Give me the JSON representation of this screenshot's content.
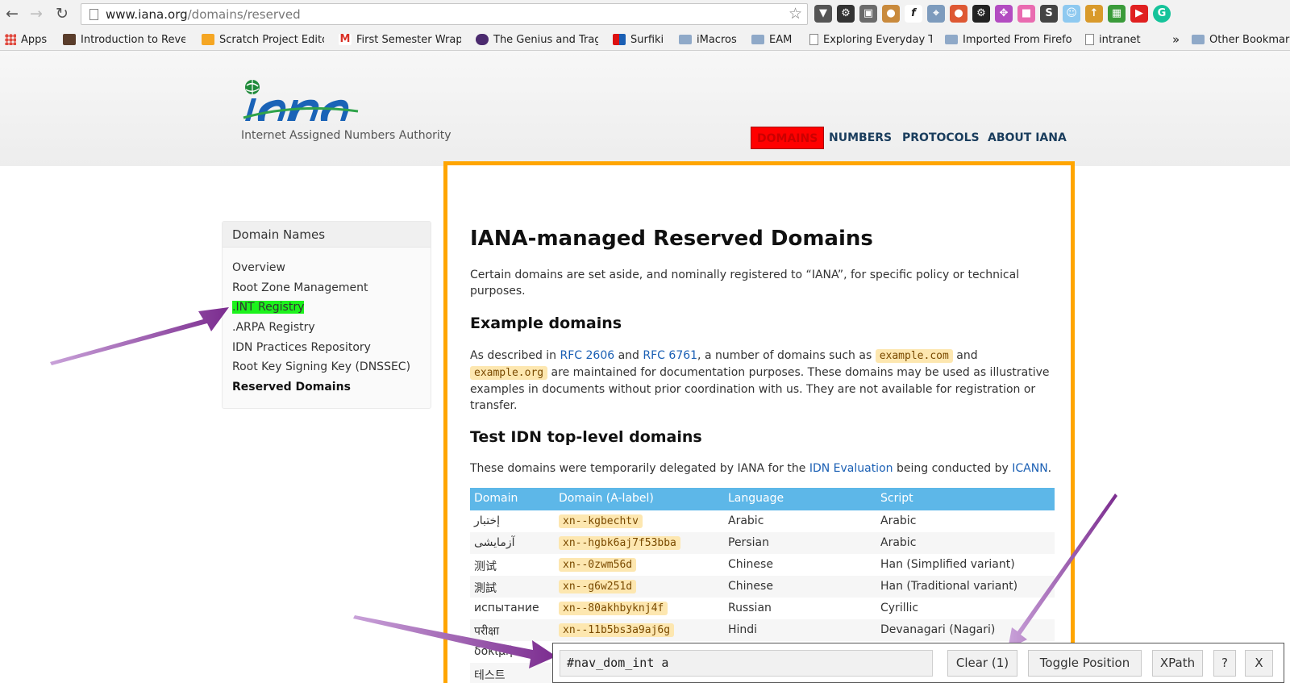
{
  "browser": {
    "url_host": "www.iana.org",
    "url_path": "/domains/reserved",
    "bookmarks": [
      {
        "label": "Apps"
      },
      {
        "label": "Introduction to Rever"
      },
      {
        "label": "Scratch Project Edito"
      },
      {
        "label": "First Semester Wrap"
      },
      {
        "label": "The Genius and Trag"
      },
      {
        "label": "Surfiki"
      },
      {
        "label": "iMacros"
      },
      {
        "label": "EAM"
      },
      {
        "label": "Exploring Everyday T"
      },
      {
        "label": "Imported From Firefo"
      },
      {
        "label": "intranet"
      },
      {
        "label": "Other Bookmark"
      }
    ],
    "overflow": "»"
  },
  "site": {
    "tagline": "Internet Assigned Numbers Authority",
    "nav": [
      "DOMAINS",
      "NUMBERS",
      "PROTOCOLS",
      "ABOUT IANA"
    ]
  },
  "sidebar": {
    "title": "Domain Names",
    "items": [
      "Overview",
      "Root Zone Management",
      ".INT Registry",
      ".ARPA Registry",
      "IDN Practices Repository",
      "Root Key Signing Key (DNSSEC)",
      "Reserved Domains"
    ]
  },
  "main": {
    "title": "IANA-managed Reserved Domains",
    "intro": "Certain domains are set aside, and nominally registered to “IANA”, for specific policy or technical purposes.",
    "example_heading": "Example domains",
    "example": {
      "t1": "As described in ",
      "rfc1": "RFC 2606",
      "t2": " and ",
      "rfc2": "RFC 6761",
      "t3": ", a number of domains such as ",
      "code1": "example.com",
      "t4": " and ",
      "code2": "example.org",
      "t5": " are maintained for documentation purposes. These domains may be used as illustrative examples in documents without prior coordination with us. They are not available for registration or transfer."
    },
    "test_heading": "Test IDN top-level domains",
    "test": {
      "t1": "These domains were temporarily delegated by IANA for the ",
      "link1": "IDN Evaluation",
      "t2": " being conducted by ",
      "link2": "ICANN",
      "t3": "."
    },
    "table": {
      "headers": [
        "Domain",
        "Domain (A-label)",
        "Language",
        "Script"
      ],
      "rows": [
        [
          "إختبار",
          "xn--kgbechtv",
          "Arabic",
          "Arabic"
        ],
        [
          "آزمایشی",
          "xn--hgbk6aj7f53bba",
          "Persian",
          "Arabic"
        ],
        [
          "测试",
          "xn--0zwm56d",
          "Chinese",
          "Han (Simplified variant)"
        ],
        [
          "測試",
          "xn--g6w251d",
          "Chinese",
          "Han (Traditional variant)"
        ],
        [
          "испытание",
          "xn--80akhbyknj4f",
          "Russian",
          "Cyrillic"
        ],
        [
          "परीक्षा",
          "xn--11b5bs3a9aj6g",
          "Hindi",
          "Devanagari (Nagari)"
        ],
        [
          "δοκιμή",
          "",
          "",
          ""
        ],
        [
          "테스트",
          "",
          "",
          ""
        ]
      ]
    }
  },
  "selector_gadget": {
    "value": "#nav_dom_int a",
    "clear": "Clear (1)",
    "toggle": "Toggle Position",
    "xpath": "XPath",
    "help": "?",
    "close": "X"
  }
}
